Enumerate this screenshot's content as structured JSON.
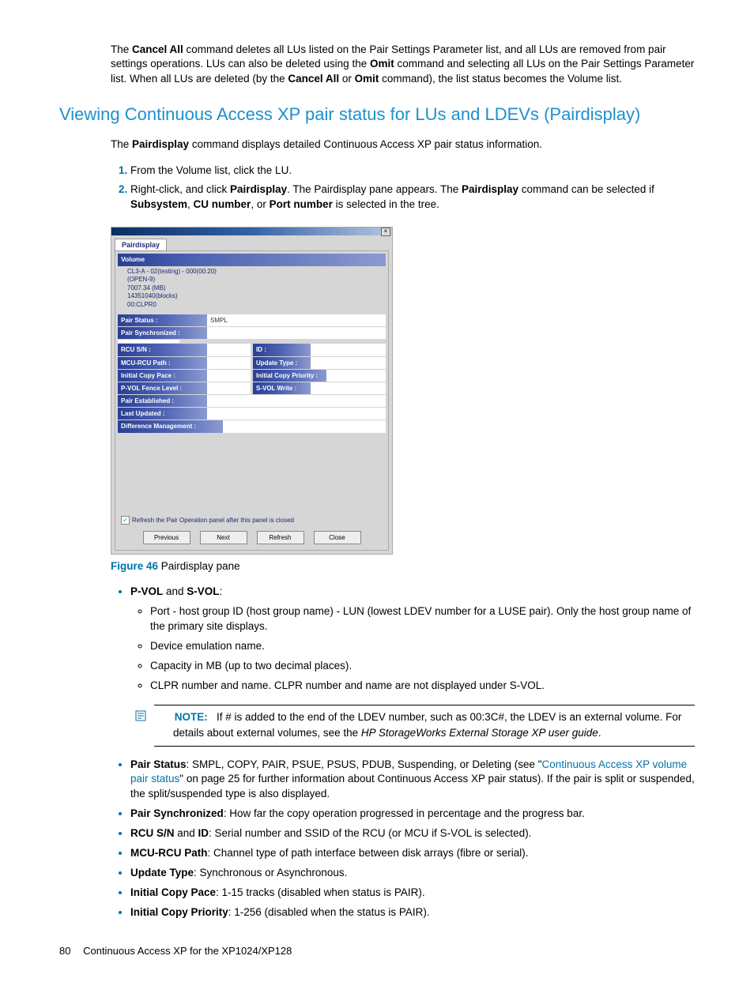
{
  "intro": {
    "p1a": "The ",
    "p1b": "Cancel All",
    "p1c": " command deletes all LUs listed on the Pair Settings Parameter list, and all LUs are removed from pair settings operations. LUs can also be deleted using the ",
    "p1d": "Omit",
    "p1e": " command and selecting all LUs on the Pair Settings Parameter list. When all LUs are deleted (by the ",
    "p1f": "Cancel All",
    "p1g": " or ",
    "p1h": "Omit",
    "p1i": " command), the list status becomes the Volume list."
  },
  "heading": "Viewing Continuous Access XP pair status for LUs and LDEVs (Pairdisplay)",
  "p2a": "The ",
  "p2b": "Pairdisplay",
  "p2c": " command displays detailed Continuous Access XP pair status information.",
  "steps": {
    "s1": "From the Volume list, click the LU.",
    "s2a": "Right-click, and click ",
    "s2b": "Pairdisplay",
    "s2c": ". The Pairdisplay pane appears. The ",
    "s2d": "Pairdisplay",
    "s2e": " command can be selected if ",
    "s2f": "Subsystem",
    "s2g": ", ",
    "s2h": "CU number",
    "s2i": ", or ",
    "s2j": "Port number",
    "s2k": " is selected in the tree."
  },
  "dialog": {
    "tab": "Pairdisplay",
    "vol_head": "Volume",
    "vol_lines": {
      "l1": "CL3-A - 02(testing) - 000(00:20)",
      "l2": "(OPEN-9)",
      "l3": "7007.34 (MB)",
      "l4": "14351040(blocks)",
      "l5": "00:CLPR0"
    },
    "rows": {
      "pair_status_l": "Pair Status :",
      "pair_status_v": "SMPL",
      "pair_sync_l": "Pair Synchronized :",
      "rcu_sn_l": "RCU S/N :",
      "id_l": "ID :",
      "mcu_rcu_l": "MCU-RCU Path :",
      "update_l": "Update Type :",
      "icp_l": "Initial Copy Pace :",
      "icpr_l": "Initial Copy Priority :",
      "pvol_l": "P-VOL Fence Level :",
      "svol_l": "S-VOL Write :",
      "pe_l": "Pair Established :",
      "lu_l": "Last Updated :",
      "dm_l": "Difference Management :"
    },
    "refresh_chk": "Refresh the Pair Operation panel after this panel is closed",
    "buttons": {
      "prev": "Previous",
      "next": "Next",
      "refresh": "Refresh",
      "close": "Close"
    }
  },
  "fig": {
    "label": "Figure 46",
    "caption": " Pairdisplay pane"
  },
  "desc": {
    "pvol_a": "P-VOL",
    "pvol_b": " and ",
    "pvol_c": "S-VOL",
    "pvol_d": ":",
    "sub1": "Port - host group ID (host group name) - LUN (lowest LDEV number for a LUSE pair). Only the host group name of the primary site displays.",
    "sub2": "Device emulation name.",
    "sub3": "Capacity in MB (up to two decimal places).",
    "sub4": "CLPR number and name. CLPR number and name are not displayed under S-VOL.",
    "note_label": "NOTE:",
    "note_text_a": "If # is added to the end of the LDEV number, such as 00:3C#, the LDEV is an external volume. For details about external volumes, see the ",
    "note_text_b": "HP StorageWorks External Storage XP user guide",
    "note_text_c": ".",
    "ps_a": "Pair Status",
    "ps_b": ": SMPL, COPY, PAIR, PSUE, PSUS, PDUB, Suspending, or Deleting (see \"",
    "ps_link": "Continuous Access XP volume pair status",
    "ps_c": "\" on page 25 for further information about Continuous Access XP pair status). If the pair is split or suspended, the split/suspended type is also displayed.",
    "psync_a": "Pair Synchronized",
    "psync_b": ": How far the copy operation progressed in percentage and the progress bar.",
    "rcu_a": "RCU S/N",
    "rcu_b": " and ",
    "rcu_c": "ID",
    "rcu_d": ": Serial number and SSID of the RCU (or MCU if S-VOL is selected).",
    "mrp_a": "MCU-RCU Path",
    "mrp_b": ": Channel type of path interface between disk arrays (fibre or serial).",
    "ut_a": "Update Type",
    "ut_b": ": Synchronous or Asynchronous.",
    "icp_a": "Initial Copy Pace",
    "icp_b": ": 1-15 tracks (disabled when status is PAIR).",
    "icpr_a": "Initial Copy Priority",
    "icpr_b": ": 1-256 (disabled when the status is PAIR)."
  },
  "footer": {
    "page": "80",
    "text": "Continuous Access XP for the XP1024/XP128"
  }
}
